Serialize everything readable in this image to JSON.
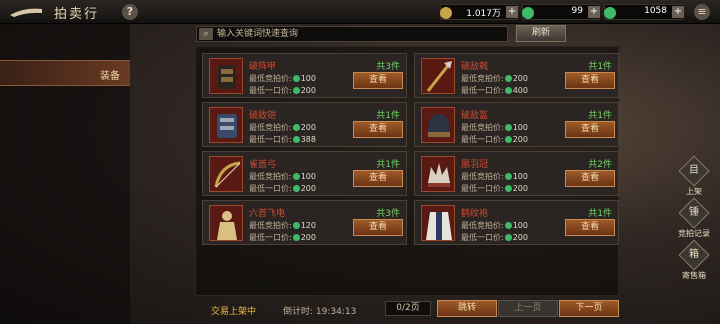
{
  "header": {
    "title": "拍卖行",
    "help": "?",
    "menu": "≡",
    "currencies": [
      {
        "icon": "copper-coin-icon",
        "value": "1.017万",
        "color": "#c9a54a"
      },
      {
        "icon": "jade-coin-icon",
        "value": "99",
        "color": "#3ebb68"
      },
      {
        "icon": "jade-bound-icon",
        "value": "1058",
        "color": "#3ebb68"
      }
    ],
    "plus": "+"
  },
  "sidebar": {
    "active_tab": "装备"
  },
  "search": {
    "placeholder": "输入关键词快速查询",
    "refresh": "刷新"
  },
  "items": [
    {
      "name": "破阵甲",
      "count": "共3件",
      "bid_label": "最低竞拍价:",
      "bid": "100",
      "buyout_label": "最低一口价:",
      "buyout": "200",
      "button": "查看"
    },
    {
      "name": "破敌戟",
      "count": "共1件",
      "bid_label": "最低竞拍价:",
      "bid": "200",
      "buyout_label": "最低一口价:",
      "buyout": "400",
      "button": "查看"
    },
    {
      "name": "破敌铠",
      "count": "共1件",
      "bid_label": "最低竞拍价:",
      "bid": "200",
      "buyout_label": "最低一口价:",
      "buyout": "388",
      "button": "查看"
    },
    {
      "name": "破敌盔",
      "count": "共1件",
      "bid_label": "最低竞拍价:",
      "bid": "100",
      "buyout_label": "最低一口价:",
      "buyout": "200",
      "button": "查看"
    },
    {
      "name": "雀首弓",
      "count": "共1件",
      "bid_label": "最低竞拍价:",
      "bid": "100",
      "buyout_label": "最低一口价:",
      "buyout": "200",
      "button": "查看"
    },
    {
      "name": "凰羽冠",
      "count": "共2件",
      "bid_label": "最低竞拍价:",
      "bid": "100",
      "buyout_label": "最低一口价:",
      "buyout": "200",
      "button": "查看"
    },
    {
      "name": "六首飞电",
      "count": "共3件",
      "bid_label": "最低竞拍价:",
      "bid": "120",
      "buyout_label": "最低一口价:",
      "buyout": "200",
      "button": "查看"
    },
    {
      "name": "鹤纹袍",
      "count": "共1件",
      "bid_label": "最低竞拍价:",
      "bid": "100",
      "buyout_label": "最低一口价:",
      "buyout": "200",
      "button": "查看"
    }
  ],
  "side_buttons": [
    {
      "label": "上架",
      "icon": "list-icon",
      "glyph": "目"
    },
    {
      "label": "竞拍记录",
      "icon": "gavel-icon",
      "glyph": "锤"
    },
    {
      "label": "寄售箱",
      "icon": "box-icon",
      "glyph": "箱"
    }
  ],
  "footer": {
    "listed_label": "交易上架中",
    "timer_label": "倒计时:",
    "timer": "19:34:13",
    "page": "0/2页",
    "jump": "跳转",
    "prev": "上一页",
    "next": "下一页"
  }
}
